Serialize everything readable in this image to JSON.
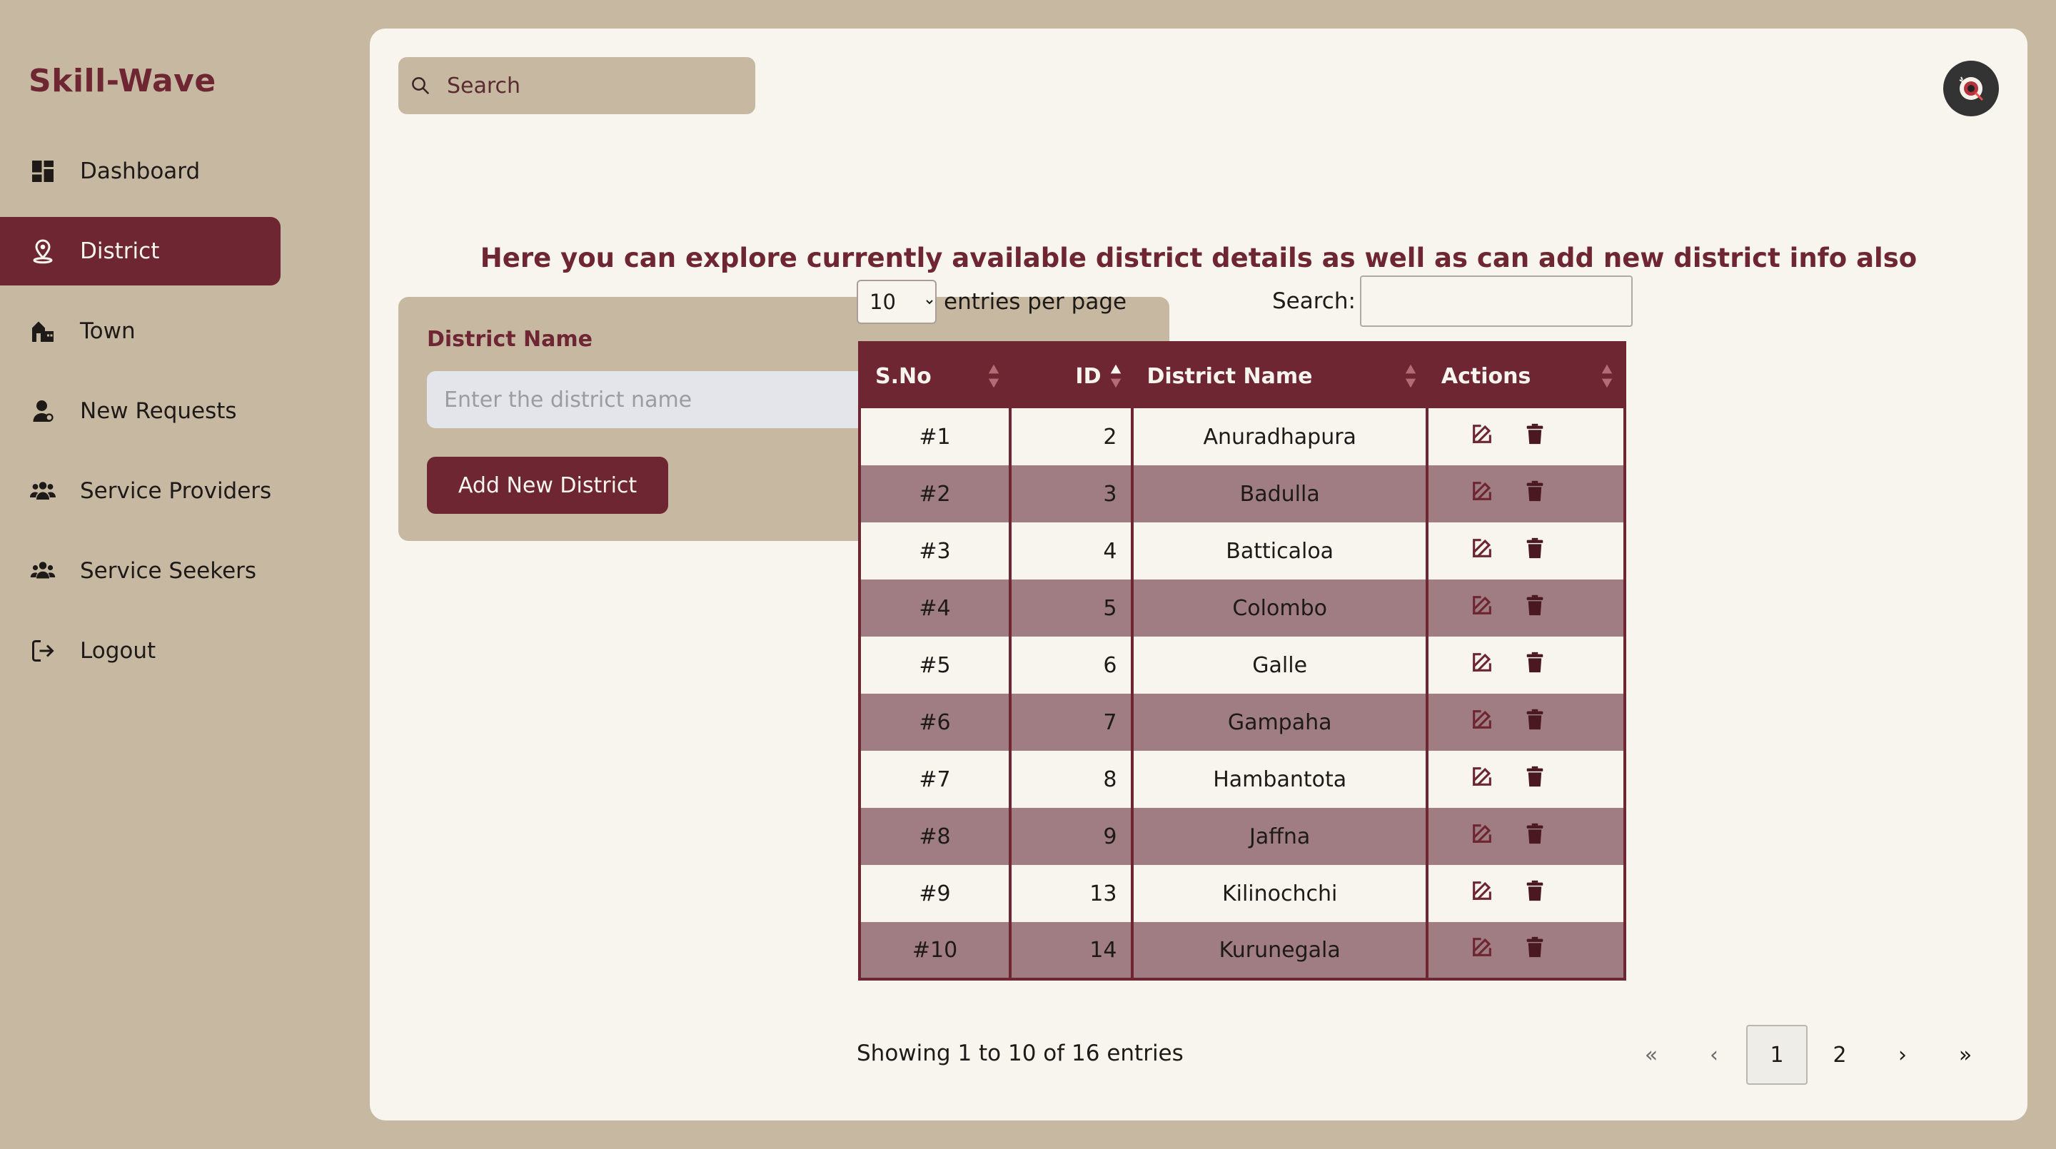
{
  "brand": "Skill-Wave",
  "colors": {
    "accent": "#6e2632",
    "sidebar_bg": "#c7b8a2",
    "panel_bg": "#f8f5ef",
    "row_alt": "#a07c83"
  },
  "sidebar": {
    "items": [
      {
        "label": "Dashboard",
        "icon": "dashboard-icon",
        "active": false
      },
      {
        "label": "District",
        "icon": "location-pin-icon",
        "active": true
      },
      {
        "label": "Town",
        "icon": "town-buildings-icon",
        "active": false
      },
      {
        "label": "New Requests",
        "icon": "user-icon",
        "active": false
      },
      {
        "label": "Service Providers",
        "icon": "users-group-icon",
        "active": false
      },
      {
        "label": "Service Seekers",
        "icon": "users-icon",
        "active": false
      },
      {
        "label": "Logout",
        "icon": "logout-icon",
        "active": false
      }
    ]
  },
  "header": {
    "search_placeholder": "Search",
    "avatar_icon": "avatar-icon"
  },
  "headline": "Here you can explore currently available district details as well as can add new district info also",
  "form": {
    "label": "District Name",
    "placeholder": "Enter the district name",
    "button": "Add New District"
  },
  "table_controls": {
    "page_size": "10",
    "entries_label": "entries per page",
    "search_label": "Search:"
  },
  "table": {
    "columns": [
      "S.No",
      "ID",
      "District Name",
      "Actions"
    ],
    "rows": [
      {
        "sno": "#1",
        "id": "2",
        "name": "Anuradhapura"
      },
      {
        "sno": "#2",
        "id": "3",
        "name": "Badulla"
      },
      {
        "sno": "#3",
        "id": "4",
        "name": "Batticaloa"
      },
      {
        "sno": "#4",
        "id": "5",
        "name": "Colombo"
      },
      {
        "sno": "#5",
        "id": "6",
        "name": "Galle"
      },
      {
        "sno": "#6",
        "id": "7",
        "name": "Gampaha"
      },
      {
        "sno": "#7",
        "id": "8",
        "name": "Hambantota"
      },
      {
        "sno": "#8",
        "id": "9",
        "name": "Jaffna"
      },
      {
        "sno": "#9",
        "id": "13",
        "name": "Kilinochchi"
      },
      {
        "sno": "#10",
        "id": "14",
        "name": "Kurunegala"
      }
    ]
  },
  "footer": {
    "showing": "Showing 1 to 10 of 16 entries",
    "pager": [
      "«",
      "‹",
      "1",
      "2",
      "›",
      "»"
    ]
  }
}
